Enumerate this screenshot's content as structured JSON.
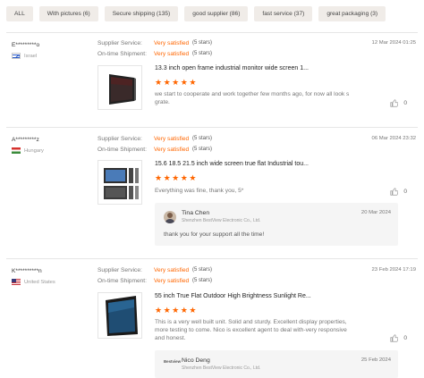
{
  "filters": [
    {
      "label": "ALL"
    },
    {
      "label": "With pictures (6)"
    },
    {
      "label": "Secure shipping (135)"
    },
    {
      "label": "good supplier (86)"
    },
    {
      "label": "fast service (37)"
    },
    {
      "label": "great packaging (3)"
    }
  ],
  "labels": {
    "supplier_service": "Supplier Service:",
    "ontime_shipment": "On-time Shipment:"
  },
  "reviews": [
    {
      "user": "E*********o",
      "country": "Israel",
      "supplier_service": "Very satisfied",
      "supplier_service_stars": "(5 stars)",
      "ontime_shipment": "Very satisfied",
      "ontime_shipment_stars": "(5 stars)",
      "date": "12 Mar 2024 01:25",
      "product_title": "13.3 inch open frame industrial monitor wide screen 1...",
      "rating": 5,
      "text": "we start to cooperate and work together few months ago, for now all look s grate.",
      "likes": "0"
    },
    {
      "user": "A*********z",
      "country": "Hungary",
      "supplier_service": "Very satisfied",
      "supplier_service_stars": "(5 stars)",
      "ontime_shipment": "Very satisfied",
      "ontime_shipment_stars": "(5 stars)",
      "date": "06 Mar 2024 23:32",
      "product_title": "15.6 18.5 21.5 inch wide screen true flat Industrial tou...",
      "rating": 5,
      "text": "Everything was fine, thank you, 5*",
      "likes": "0",
      "reply": {
        "name": "Tina Chen",
        "company": "Shenzhen BestView Electronic Co., Ltd.",
        "date": "20 Mar 2024",
        "text": "thank you for your support all the time!"
      }
    },
    {
      "user": "K**********n",
      "country": "United States",
      "supplier_service": "Very satisfied",
      "supplier_service_stars": "(5 stars)",
      "ontime_shipment": "Very satisfied",
      "ontime_shipment_stars": "(5 stars)",
      "date": "23 Feb 2024 17:19",
      "product_title": "55 inch True Flat Outdoor High Brightness Sunlight Re...",
      "rating": 5,
      "text": "This is a very well built unit. Solid and sturdy. Excellent display properties, more testing to come. Nico is excellent agent to deal with-very responsive and honest.",
      "likes": "0",
      "reply": {
        "name": "Nico Deng",
        "company": "Shenzhen BestView Electronic Co., Ltd.",
        "date": "25 Feb 2024",
        "logo_text": "Bestview",
        "text": ""
      }
    }
  ],
  "colors": {
    "accent": "#ff6600",
    "chip_bg": "#f0ece8",
    "reply_bg": "#f5f5f5"
  },
  "icons": {
    "like": "thumbs-up-icon",
    "star": "star-icon"
  }
}
